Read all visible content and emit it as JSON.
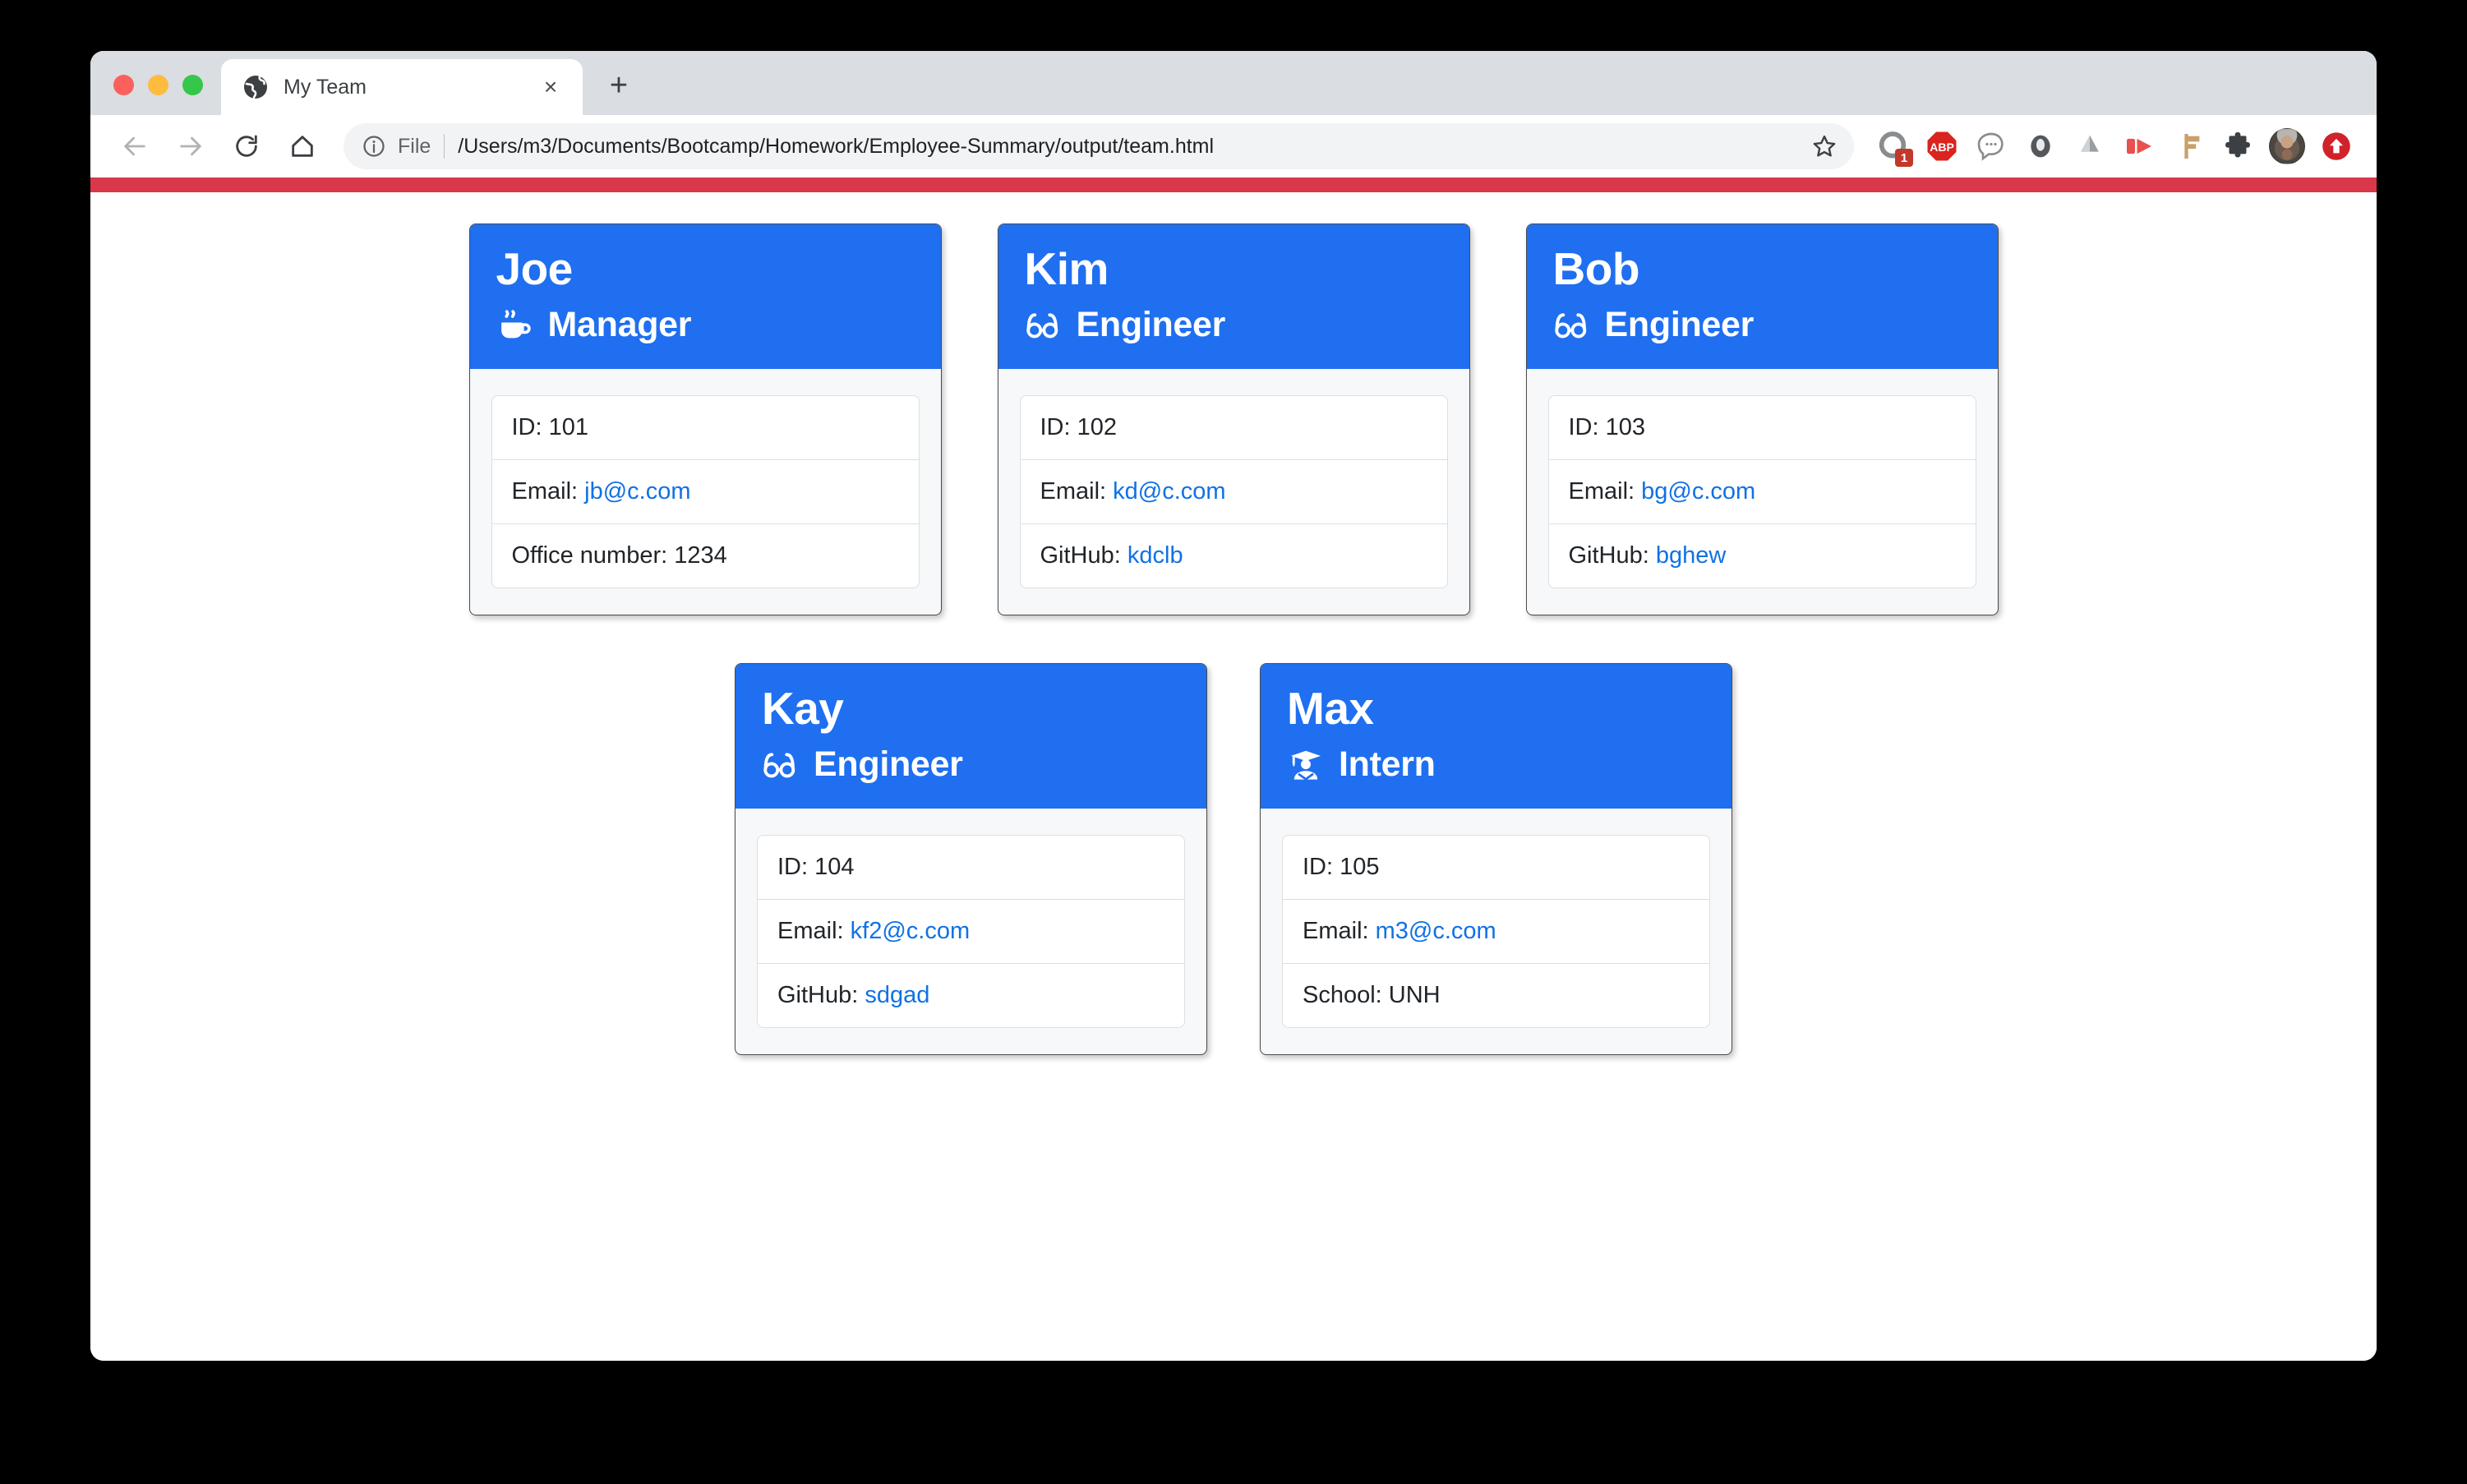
{
  "browser": {
    "tab": {
      "title": "My Team",
      "favicon": "globe-icon",
      "close_label": "×"
    },
    "new_tab_label": "+",
    "nav": {
      "back_label": "Back",
      "forward_label": "Forward",
      "reload_label": "Reload",
      "home_label": "Home"
    },
    "omnibox": {
      "scheme_label": "File",
      "url": "/Users/m3/Documents/Bootcamp/Homework/Employee-Summary/output/team.html",
      "star_label": "Bookmark this page"
    },
    "extensions": [
      {
        "name": "grammar-checker-icon",
        "badge": "1"
      },
      {
        "name": "adblock-plus-icon",
        "label": "ABP"
      },
      {
        "name": "voice-assistant-icon"
      },
      {
        "name": "dark-oval-extension-icon"
      },
      {
        "name": "google-drive-icon"
      },
      {
        "name": "video-downloader-icon"
      },
      {
        "name": "signpost-extension-icon"
      },
      {
        "name": "extensions-puzzle-icon"
      },
      {
        "name": "profile-avatar"
      },
      {
        "name": "upload-arrow-icon"
      }
    ]
  },
  "theme": {
    "header_blue": "#1f6ff0",
    "banner_red": "#d8384a",
    "link_blue": "#1071e5",
    "card_body_grey": "#f6f8f9"
  },
  "team": {
    "rows": [
      {
        "cards": [
          {
            "name": "Joe",
            "role": "Manager",
            "role_icon": "coffee-mug-icon",
            "info": [
              {
                "label": "ID: ",
                "value": "101",
                "link": false
              },
              {
                "label": "Email: ",
                "value": "jb@c.com",
                "link": true
              },
              {
                "label": "Office number: ",
                "value": "1234",
                "link": false
              }
            ]
          },
          {
            "name": "Kim",
            "role": "Engineer",
            "role_icon": "eyeglasses-icon",
            "info": [
              {
                "label": "ID: ",
                "value": "102",
                "link": false
              },
              {
                "label": "Email: ",
                "value": "kd@c.com",
                "link": true
              },
              {
                "label": "GitHub: ",
                "value": "kdclb",
                "link": true
              }
            ]
          },
          {
            "name": "Bob",
            "role": "Engineer",
            "role_icon": "eyeglasses-icon",
            "info": [
              {
                "label": "ID: ",
                "value": "103",
                "link": false
              },
              {
                "label": "Email: ",
                "value": "bg@c.com",
                "link": true
              },
              {
                "label": "GitHub: ",
                "value": "bghew",
                "link": true
              }
            ]
          }
        ]
      },
      {
        "cards": [
          {
            "name": "Kay",
            "role": "Engineer",
            "role_icon": "eyeglasses-icon",
            "info": [
              {
                "label": "ID: ",
                "value": "104",
                "link": false
              },
              {
                "label": "Email: ",
                "value": "kf2@c.com",
                "link": true
              },
              {
                "label": "GitHub: ",
                "value": "sdgad",
                "link": true
              }
            ]
          },
          {
            "name": "Max",
            "role": "Intern",
            "role_icon": "graduate-icon",
            "info": [
              {
                "label": "ID: ",
                "value": "105",
                "link": false
              },
              {
                "label": "Email: ",
                "value": "m3@c.com",
                "link": true
              },
              {
                "label": "School: ",
                "value": "UNH",
                "link": false
              }
            ]
          }
        ]
      }
    ]
  }
}
